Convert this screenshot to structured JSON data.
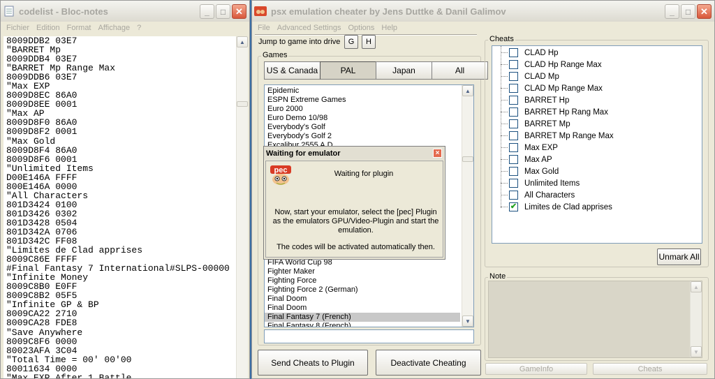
{
  "notepad": {
    "title": "codelist - Bloc-notes",
    "menu": [
      "Fichier",
      "Edition",
      "Format",
      "Affichage",
      "?"
    ],
    "lines": [
      "8009DDB2 03E7",
      "\"BARRET Mp",
      "8009DDB4 03E7",
      "\"BARRET Mp Range Max",
      "8009DDB6 03E7",
      "\"Max EXP",
      "8009D8EC 86A0",
      "8009D8EE 0001",
      "\"Max AP",
      "8009D8F0 86A0",
      "8009D8F2 0001",
      "\"Max Gold",
      "8009D8F4 86A0",
      "8009D8F6 0001",
      "\"Unlimited Items",
      "D00E146A FFFF",
      "800E146A 0000",
      "\"All Characters",
      "801D3424 0100",
      "801D3426 0302",
      "801D3428 0504",
      "801D342A 0706",
      "801D342C FF08",
      "\"Limites de Clad apprises",
      "8009C86E FFFF",
      "#Final Fantasy 7 International#SLPS-00000",
      "\"Infinite Money",
      "8009C8B0 E0FF",
      "8009C8B2 05F5",
      "\"Infinite GP & BP",
      "8009CA22 2710",
      "8009CA28 FDE8",
      "\"Save Anywhere",
      "8009C8F6 0000",
      "80023AFA 3C04",
      "\"Total Time = 00' 00'00",
      "80011634 0000",
      "\"Max EXP After 1 Battle"
    ]
  },
  "psx": {
    "title": "psx emulation cheater by Jens Duttke & Danil Galimov",
    "menu": [
      "File",
      "Advanced Settings",
      "Options",
      "Help"
    ],
    "jump_label": "Jump to game into drive",
    "jump_g": "G",
    "jump_h": "H",
    "games_label": "Games",
    "tabs": [
      "US & Canada",
      "PAL",
      "Japan",
      "All"
    ],
    "active_tab": "PAL",
    "games_top": [
      "Epidemic",
      "ESPN Extreme Games",
      "Euro 2000",
      "Euro Demo 10/98",
      "Everybody's Golf",
      "Everybody's Golf 2",
      "Excalibur 2555 A.D."
    ],
    "games_bottom": [
      "FIFA World Cup 98",
      "Fighter Maker",
      "Fighting Force",
      "Fighting Force 2 (German)",
      "Final Doom",
      "Final Doom",
      "Final Fantasy 7 (French)",
      "Final Fantasy 8 (French)"
    ],
    "selected_game": "Final Fantasy 7 (French)",
    "send_button": "Send Cheats to Plugin",
    "deactivate_button": "Deactivate Cheating",
    "cheats_label": "Cheats",
    "cheats": [
      {
        "label": "CLAD Hp",
        "checked": false
      },
      {
        "label": "CLAD Hp Range Max",
        "checked": false
      },
      {
        "label": "CLAD Mp",
        "checked": false
      },
      {
        "label": "CLAD Mp Range Max",
        "checked": false
      },
      {
        "label": "BARRET Hp",
        "checked": false
      },
      {
        "label": "BARRET Hp Rang Max",
        "checked": false
      },
      {
        "label": "BARRET Mp",
        "checked": false
      },
      {
        "label": "BARRET Mp Range Max",
        "checked": false
      },
      {
        "label": "Max EXP",
        "checked": false
      },
      {
        "label": "Max AP",
        "checked": false
      },
      {
        "label": "Max Gold",
        "checked": false
      },
      {
        "label": "Unlimited Items",
        "checked": false
      },
      {
        "label": "All Characters",
        "checked": false
      },
      {
        "label": "Limites de Clad apprises",
        "checked": true
      }
    ],
    "unmark_button": "Unmark All",
    "note_label": "Note",
    "gameinfo_button": "GameInfo",
    "cheats_button": "Cheats"
  },
  "dialog": {
    "title": "Waiting for emulator",
    "close": "×",
    "heading": "Waiting for plugin",
    "logo_text": "pec",
    "body": "Now, start your emulator, select the [pec] Plugin as the emulators GPU/Video-Plugin and start the emulation.",
    "footer": "The codes will be activated automatically then."
  }
}
